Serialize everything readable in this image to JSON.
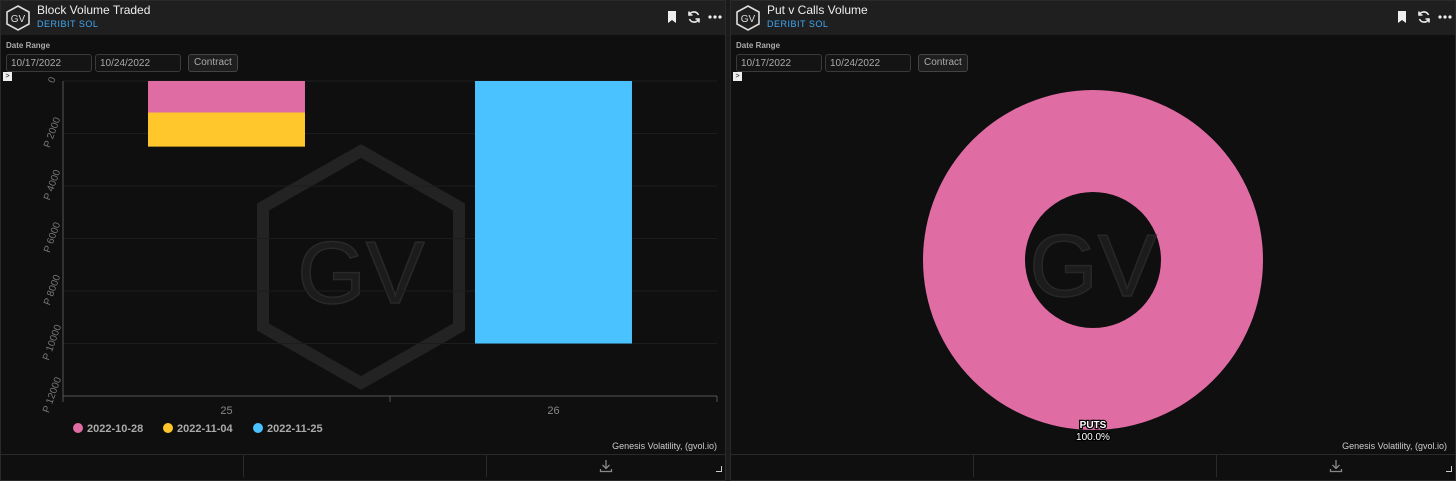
{
  "panels": {
    "left": {
      "title": "Block Volume Traded",
      "subtitle": "DERIBIT SOL",
      "date_range_label": "Date Range",
      "start_date": "10/17/2022",
      "end_date": "10/24/2022",
      "contract_label": "Contract",
      "credit": "Genesis Volatility, (gvol.io)"
    },
    "right": {
      "title": "Put v Calls Volume",
      "subtitle": "DERIBIT SOL",
      "date_range_label": "Date Range",
      "start_date": "10/17/2022",
      "end_date": "10/24/2022",
      "contract_label": "Contract",
      "credit": "Genesis Volatility, (gvol.io)"
    }
  },
  "watermark": "GV",
  "chart_data": [
    {
      "type": "bar",
      "stacked": true,
      "categories": [
        "25",
        "26"
      ],
      "y_tick_labels": [
        "0",
        "P 2000",
        "P 4000",
        "P 6000",
        "P 8000",
        "P 10000",
        "P 12000"
      ],
      "ylim": [
        0,
        12000
      ],
      "y_reversed": true,
      "series": [
        {
          "name": "2022-10-28",
          "color": "#e06ca4",
          "values": [
            1200,
            0
          ]
        },
        {
          "name": "2022-11-04",
          "color": "#ffc72c",
          "values": [
            1300,
            0
          ]
        },
        {
          "name": "2022-11-25",
          "color": "#4ac2ff",
          "values": [
            0,
            10000
          ]
        }
      ],
      "legend_position": "bottom-left"
    },
    {
      "type": "pie",
      "donut": true,
      "slices": [
        {
          "label": "PUTS",
          "percent_label": "100.0%",
          "value": 100,
          "color": "#e06ca4"
        }
      ]
    }
  ]
}
